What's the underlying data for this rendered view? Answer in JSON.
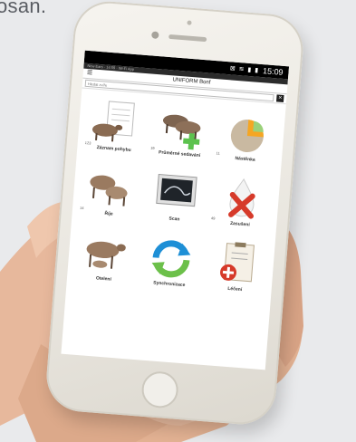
{
  "background": {
    "text": "osan."
  },
  "status_bar": {
    "time": "15:09",
    "icons": "⊠ ≋ ▮ ▮"
  },
  "notification_bar": {
    "text": "New Ears · 14:59 · Wi-Fi App"
  },
  "app_bar": {
    "menu_icon": "hamburger-icon",
    "title": "UNIFORM Bonf"
  },
  "search": {
    "placeholder": "Hledat zvíře",
    "close_icon": "close-icon"
  },
  "tiles": [
    {
      "label": "Záznam pohybu",
      "count": "123"
    },
    {
      "label": "Průměrné sedavání",
      "count": "19"
    },
    {
      "label": "Nástěnka",
      "count": "11"
    },
    {
      "label": "Říje",
      "count": "14"
    },
    {
      "label": "Scan",
      "count": ""
    },
    {
      "label": "Zasušení",
      "count": "49"
    },
    {
      "label": "Otelení",
      "count": ""
    },
    {
      "label": "Synchronizace",
      "count": ""
    },
    {
      "label": "Léčení",
      "count": ""
    }
  ],
  "colors": {
    "pie_orange": "#f5a623",
    "pie_green": "#9bd17a",
    "red_x": "#d63a2a",
    "plus_green": "#5cc24e",
    "sync_blue": "#1e8fd6",
    "sync_green": "#6cc04a"
  }
}
